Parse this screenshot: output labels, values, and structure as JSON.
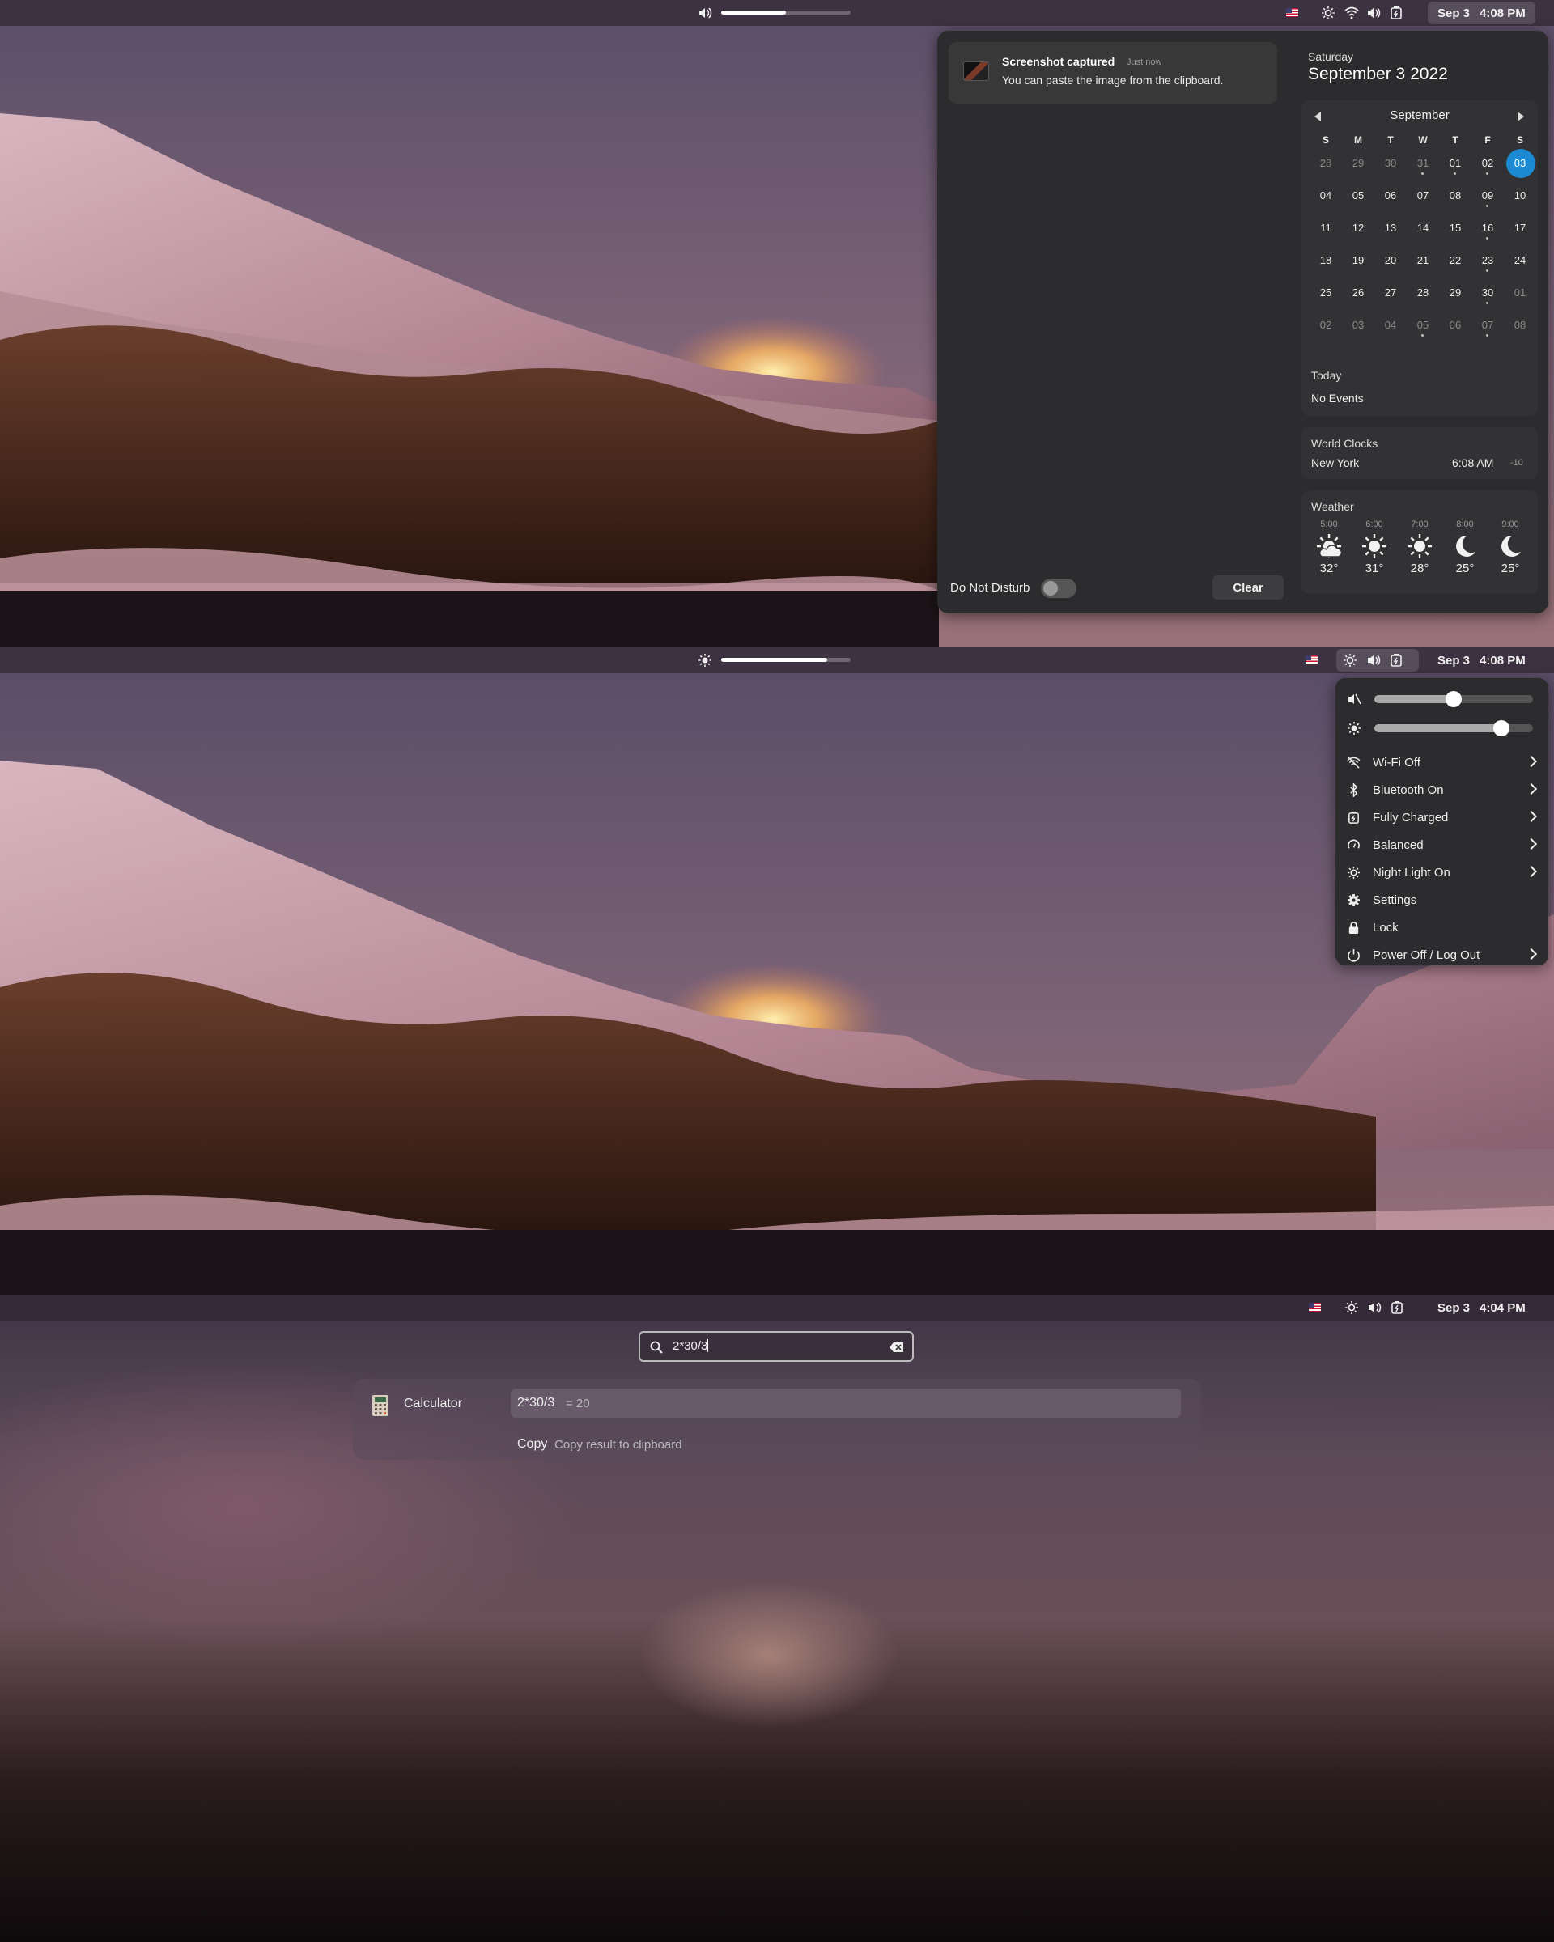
{
  "section1": {
    "topbar": {
      "date": "Sep 3",
      "time": "4:08 PM",
      "volume_level": 0.5
    },
    "notification": {
      "title": "Screenshot captured",
      "time": "Just now",
      "body": "You can paste the image from the clipboard."
    },
    "dnd_label": "Do Not Disturb",
    "clear_label": "Clear",
    "weekday": "Saturday",
    "full_date": "September 3 2022",
    "calendar": {
      "month": "September",
      "weekdays": [
        "S",
        "M",
        "T",
        "W",
        "T",
        "F",
        "S"
      ],
      "days": [
        [
          "28",
          "29",
          "30",
          "31",
          "01",
          "02",
          "03"
        ],
        [
          "04",
          "05",
          "06",
          "07",
          "08",
          "09",
          "10"
        ],
        [
          "11",
          "12",
          "13",
          "14",
          "15",
          "16",
          "17"
        ],
        [
          "18",
          "19",
          "20",
          "21",
          "22",
          "23",
          "24"
        ],
        [
          "25",
          "26",
          "27",
          "28",
          "29",
          "30",
          "01"
        ],
        [
          "02",
          "03",
          "04",
          "05",
          "06",
          "07",
          "08"
        ]
      ],
      "selected_day": "03"
    },
    "today_title": "Today",
    "today_text": "No Events",
    "world_clocks_title": "World Clocks",
    "clock_city": "New York",
    "clock_time": "6:08 AM",
    "clock_offset": "-10",
    "weather_title": "Weather",
    "weather": [
      {
        "hour": "5:00",
        "temp": "32°",
        "icon": "partly-sunny-icon"
      },
      {
        "hour": "6:00",
        "temp": "31°",
        "icon": "sun-icon"
      },
      {
        "hour": "7:00",
        "temp": "28°",
        "icon": "sun-icon"
      },
      {
        "hour": "8:00",
        "temp": "25°",
        "icon": "moon-icon"
      },
      {
        "hour": "9:00",
        "temp": "25°",
        "icon": "moon-icon"
      }
    ]
  },
  "section2": {
    "topbar": {
      "date": "Sep 3",
      "time": "4:08 PM",
      "brightness_level": 0.82
    },
    "quick_settings": {
      "volume_level": 0.5,
      "brightness_level": 0.8,
      "items": [
        {
          "label": "Wi-Fi Off",
          "icon": "wifi-off-icon",
          "chevron": true
        },
        {
          "label": "Bluetooth On",
          "icon": "bluetooth-icon",
          "chevron": true
        },
        {
          "label": "Fully Charged",
          "icon": "battery-icon",
          "chevron": true
        },
        {
          "label": "Balanced",
          "icon": "power-mode-icon",
          "chevron": true
        },
        {
          "label": "Night Light On",
          "icon": "night-light-icon",
          "chevron": true
        },
        {
          "label": "Settings",
          "icon": "gear-icon",
          "chevron": false
        },
        {
          "label": "Lock",
          "icon": "lock-icon",
          "chevron": false
        },
        {
          "label": "Power Off / Log Out",
          "icon": "power-icon",
          "chevron": true
        }
      ]
    }
  },
  "section3": {
    "topbar": {
      "date": "Sep 3",
      "time": "4:04 PM"
    },
    "search_value": "2*30/3",
    "result": {
      "app_name": "Calculator",
      "expression": "2*30/3",
      "answer": "= 20",
      "action": "Copy",
      "action_desc": "Copy result to clipboard"
    }
  },
  "colors": {
    "accent": "#1c8ad2",
    "panel": "#2c2c2e",
    "topbar": "#3a303e"
  }
}
